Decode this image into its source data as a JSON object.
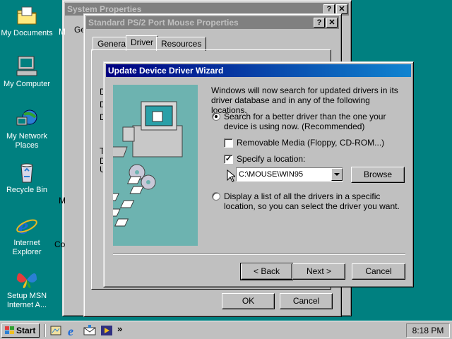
{
  "desktop": {
    "icons": [
      {
        "label": "My Documents",
        "icon": "folder-icon"
      },
      {
        "label": "My Computer",
        "icon": "computer-icon"
      },
      {
        "label": "My Network Places",
        "icon": "network-icon"
      },
      {
        "label": "Recycle Bin",
        "icon": "recycle-bin-icon"
      },
      {
        "label": "Internet Explorer",
        "icon": "internet-explorer-icon"
      },
      {
        "label": "Setup MSN Internet A...",
        "icon": "msn-butterfly-icon"
      }
    ]
  },
  "system_properties": {
    "title": "System Properties",
    "partial_labels": [
      "Ge",
      "M",
      "M",
      "Co"
    ]
  },
  "mouse_properties": {
    "title": "Standard PS/2 Port Mouse Properties",
    "tabs": [
      "General",
      "Driver",
      "Resources"
    ],
    "active_tab": "Driver",
    "ok_label": "OK",
    "cancel_label": "Cancel",
    "partial_labels": [
      "D",
      "D",
      "D",
      "T",
      "D",
      "U"
    ]
  },
  "wizard": {
    "title": "Update Device Driver Wizard",
    "intro": "Windows will now search for updated drivers in its driver database and in any of the following locations.",
    "option_search": "Search for a better driver than the one your device is using now. (Recommended)",
    "option_search_selected": true,
    "removable_media_label": "Removable Media (Floppy, CD-ROM...)",
    "removable_media_checked": false,
    "specify_location_label": "Specify a location:",
    "specify_location_checked": true,
    "location_value": "C:\\MOUSE\\WIN95",
    "browse_label": "Browse",
    "option_list": "Display a list of all the drivers in a specific location, so you can select the driver you want.",
    "option_list_selected": false,
    "back_label": "< Back",
    "next_label": "Next >",
    "cancel_label": "Cancel"
  },
  "taskbar": {
    "start_label": "Start",
    "clock": "8:18 PM",
    "overflow": "»"
  },
  "colors": {
    "desktop": "#008080",
    "title_active": "#000080",
    "title_inactive": "#808080",
    "wizard_art_bg": "#6db3b0"
  }
}
